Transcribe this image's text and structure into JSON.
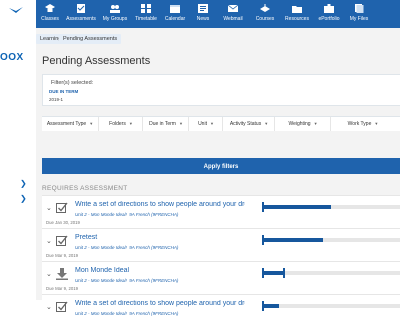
{
  "sidebar": {
    "logo_text": "OOX",
    "logo_mark_color": "#0d63b4"
  },
  "nav": {
    "items": [
      {
        "label": "Classes",
        "icon": "graduation-cap-icon"
      },
      {
        "label": "Assessments",
        "icon": "checklist-icon"
      },
      {
        "label": "My Groups",
        "icon": "group-icon"
      },
      {
        "label": "Timetable",
        "icon": "grid-icon"
      },
      {
        "label": "Calendar",
        "icon": "calendar-icon"
      },
      {
        "label": "News",
        "icon": "news-icon"
      },
      {
        "label": "Webmail",
        "icon": "mail-icon"
      },
      {
        "label": "Courses",
        "icon": "courses-icon"
      },
      {
        "label": "Resources",
        "icon": "folder-icon"
      },
      {
        "label": "ePortfolio",
        "icon": "portfolio-icon"
      },
      {
        "label": "My Files",
        "icon": "files-icon"
      }
    ],
    "bg_color": "#1f63ad"
  },
  "breadcrumbs": [
    "Learning",
    "Pending Assessments"
  ],
  "page": {
    "title": "Pending Assessments"
  },
  "filters": {
    "label": "Filter(s) selected:",
    "chip_title": "DUE IN TERM",
    "chip_value": "2019-1",
    "dropdowns": [
      "Assessment Type",
      "Folders",
      "Due in Term",
      "Unit",
      "Activity Status",
      "Weighting",
      "Work Type"
    ],
    "apply_label": "Apply filters"
  },
  "section": {
    "title": "REQUIRES ASSESSMENT"
  },
  "assessments": [
    {
      "title": "Write a set of directions to show people around your drea...",
      "unit": "Unit 2 - Mon Monde Ideal!",
      "course": "9A French (9FRENCHA)",
      "due": "Due Jan 30, 2019",
      "icon": "checkbox-icon",
      "progress": 0.5
    },
    {
      "title": "Pretest",
      "unit": "Unit 2 - Mon Monde Ideal!",
      "course": "9A French (9FRENCHA)",
      "due": "Due Mar 9, 2019",
      "icon": "checkbox-icon",
      "progress": 0.44
    },
    {
      "title": "Mon Monde Ideal",
      "unit": "Unit 2 - Mon Monde Ideal!",
      "course": "9A French (9FRENCHA)",
      "due": "Due Mar 9, 2019",
      "icon": "download-icon",
      "progress": 0.16
    },
    {
      "title": "Write a set of directions to show people around your drea...",
      "unit": "Unit 2 - Mon Monde Ideal!",
      "course": "9A French (9FRENCHA)",
      "due": "",
      "icon": "checkbox-icon",
      "progress": 0.12
    }
  ]
}
